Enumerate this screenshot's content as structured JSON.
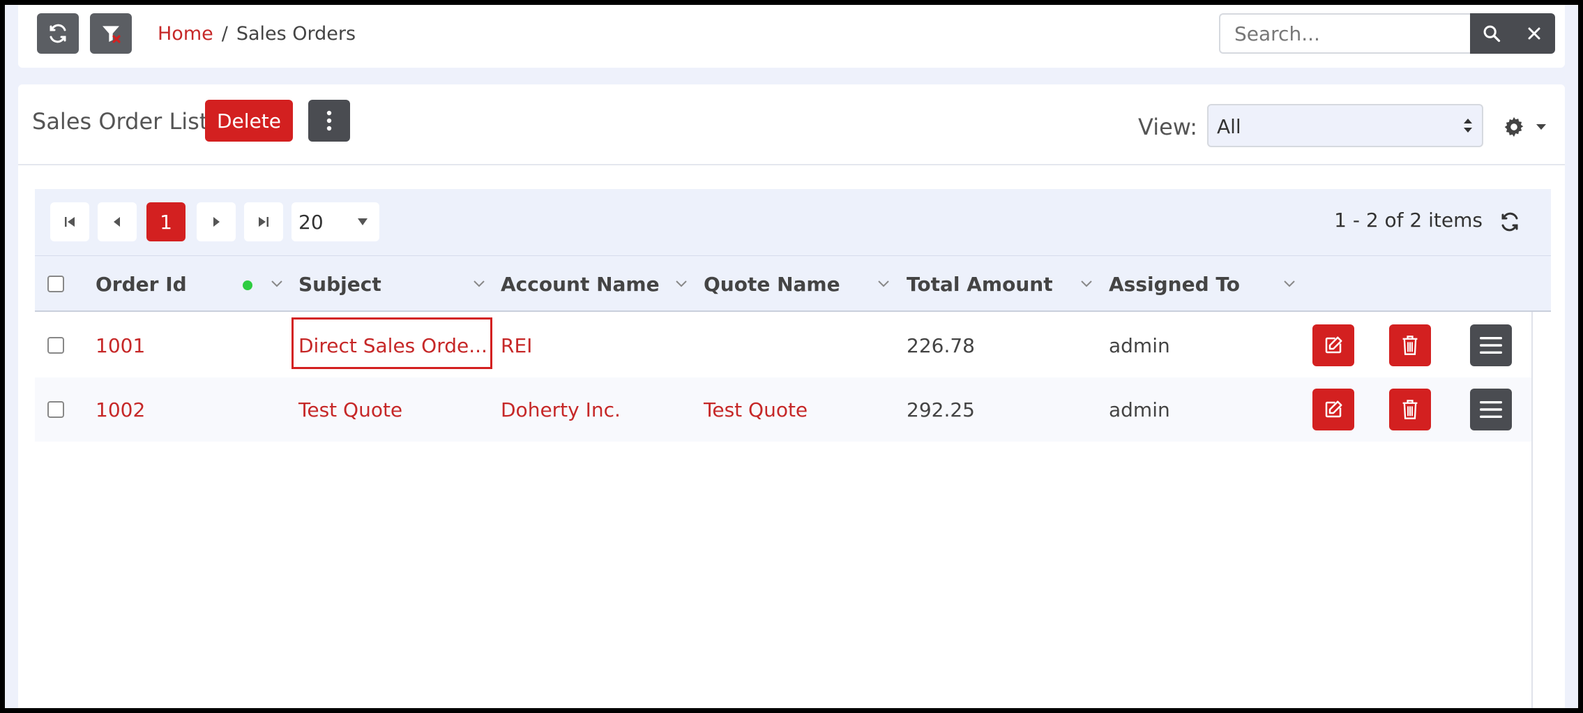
{
  "topbar": {
    "breadcrumb": {
      "home": "Home",
      "separator": "/",
      "current": "Sales Orders"
    },
    "search": {
      "placeholder": "Search..."
    }
  },
  "header": {
    "title": "Sales Order List",
    "delete_label": "Delete",
    "view_label": "View:",
    "view_value": "All"
  },
  "pager": {
    "current_page": "1",
    "page_size": "20",
    "info": "1 - 2 of 2 items"
  },
  "columns": [
    "Order Id",
    "Subject",
    "Account Name",
    "Quote Name",
    "Total Amount",
    "Assigned To"
  ],
  "rows": [
    {
      "order_id": "1001",
      "subject": "Direct Sales Orde...",
      "account": "REI",
      "quote": "",
      "total": "226.78",
      "assigned": "admin"
    },
    {
      "order_id": "1002",
      "subject": "Test Quote",
      "account": "Doherty Inc.",
      "quote": "Test Quote",
      "total": "292.25",
      "assigned": "admin"
    }
  ],
  "colors": {
    "accent": "#d32020",
    "link": "#c62828",
    "dark_button": "#4a4c51",
    "status_dot": "#2ecc40"
  }
}
